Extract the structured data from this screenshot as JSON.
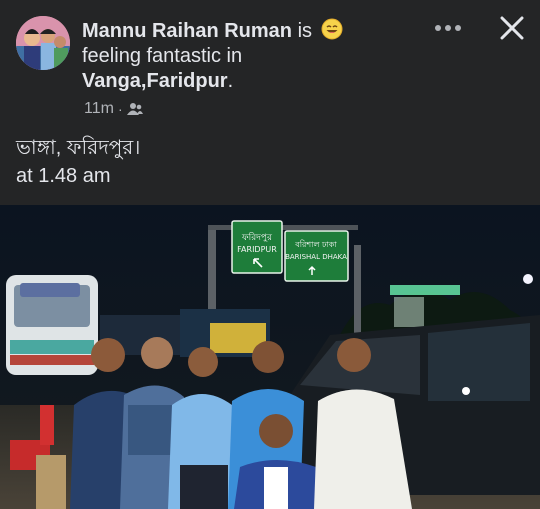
{
  "post": {
    "author": "Mannu Raihan Ruman",
    "is_word": "is",
    "feeling_text": "feeling fantastic in",
    "location": "Vanga,Faridpur",
    "location_suffix": ".",
    "timestamp": "11m",
    "meta_separator": "·",
    "audience_icon": "friends-icon",
    "caption_line1": "ভাঙ্গা, ফরিদপুর।",
    "caption_line2": "at 1.48 am",
    "feeling_emoji": "smiling-face-icon"
  },
  "actions": {
    "more_icon": "more-options-icon",
    "close_icon": "close-icon"
  },
  "photo": {
    "sign_left_line1": "ফরিদপুর",
    "sign_left_line2": "FARIDPUR",
    "sign_right_line1": "বরিশাল  ঢাকা",
    "sign_right_line2": "BARISHAL DHAKA",
    "sign_color": "#1e7d3a"
  },
  "colors": {
    "background": "#242526",
    "text_primary": "#e4e6eb",
    "text_secondary": "#b0b3b8"
  }
}
